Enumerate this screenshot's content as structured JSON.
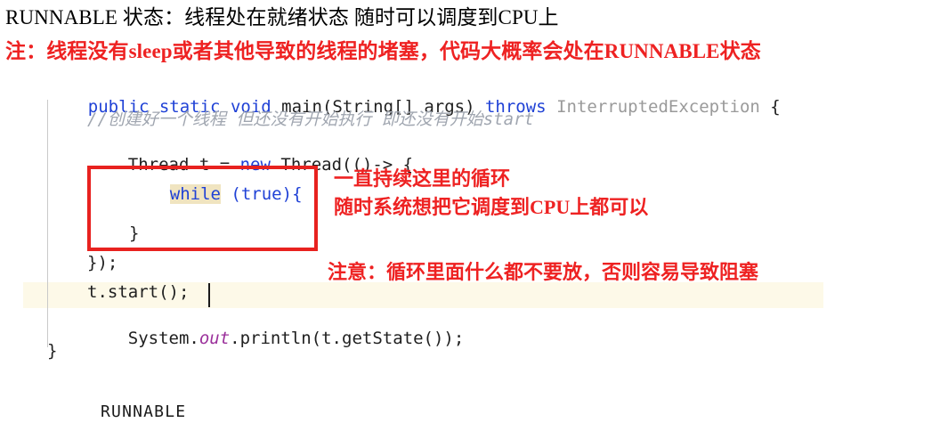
{
  "notes": {
    "title": "RUNNABLE  状态：线程处在就绪状态  随时可以调度到CPU上",
    "warning": "注：线程没有sleep或者其他导致的线程的堵塞，代码大概率会处在RUNNABLE状态"
  },
  "annotations": {
    "loop_line1": "一直持续这里的循环",
    "loop_line2": "随时系统想把它调度到CPU上都可以",
    "warning": "注意：循环里面什么都不要放，否则容易导致阻塞"
  },
  "code": {
    "line1": {
      "kw_public": "public",
      "sp1": " ",
      "kw_static": "static",
      "sp2": " ",
      "kw_void": "void",
      "sp3": " ",
      "name_main": "main",
      "params": "(String[] args) ",
      "kw_throws": "throws",
      "sp4": " ",
      "exception": "InterruptedException",
      "brace": " {"
    },
    "line2_comment": "//创建好一个线程 但还没有开始执行 即还没有开始start",
    "line3": {
      "prefix": "Thread t = ",
      "kw_new": "new",
      "suffix": " Thread(()-> {"
    },
    "line4": {
      "kw_while": "while",
      "paren_open": " (",
      "kw_true": "true",
      "tail": "){"
    },
    "line5_close_brace": "}",
    "line6_lambda_end": "});",
    "line7_start": "t.start();",
    "line8": {
      "prefix": "System.",
      "field_out": "out",
      "suffix": ".println(t.getState());"
    },
    "line9_close": "}"
  },
  "console": {
    "output": "RUNNABLE"
  },
  "colors": {
    "keyword": "#1f41d6",
    "comment": "#a0a6b0",
    "annotation_red": "#ee2222",
    "box_red": "#e8221f",
    "current_line": "#fdf9e8",
    "keyword_highlight": "#f0e4c0",
    "field_purple": "#9b309b",
    "type_gray": "#9a9a9a"
  }
}
